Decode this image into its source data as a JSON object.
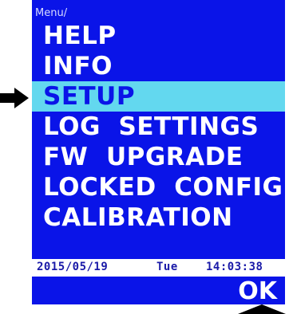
{
  "breadcrumb": "Menu/",
  "menu": {
    "items": [
      {
        "label": "HELP"
      },
      {
        "label": "INFO"
      },
      {
        "label": "SETUP"
      },
      {
        "label": "LOG  SETTINGS"
      },
      {
        "label": "FW  UPGRADE"
      },
      {
        "label": "LOCKED  CONFIG"
      },
      {
        "label": "CALIBRATION"
      }
    ],
    "selected_index": 2
  },
  "status": {
    "date": "2015/05/19",
    "day": "Tue",
    "time": "14:03:38"
  },
  "softkey": {
    "ok_label": "OK"
  },
  "icons": {
    "pointer": "arrow-right-icon",
    "softkey_indicator": "arrow-up-icon"
  },
  "colors": {
    "panel": "#0a14e8",
    "highlight": "#63d8ef",
    "text": "#ffffff",
    "status_text": "#1a1aa8"
  }
}
